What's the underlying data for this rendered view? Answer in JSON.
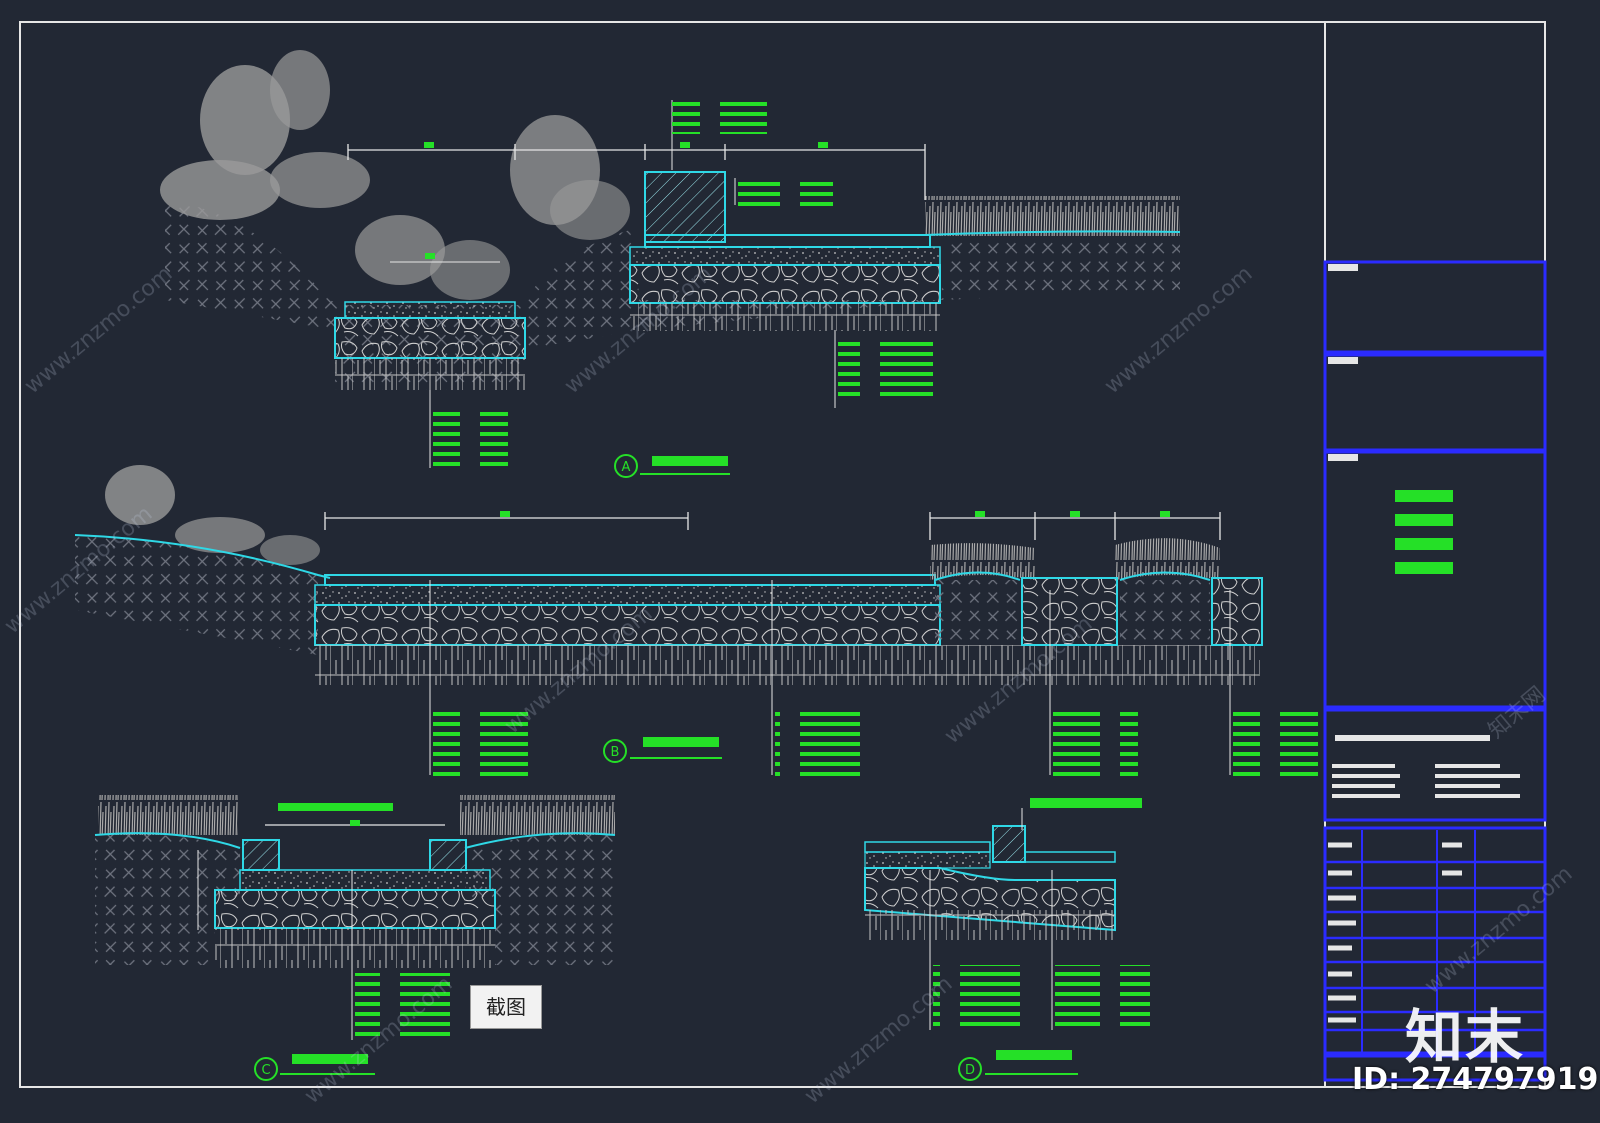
{
  "watermark": {
    "brand": "知末",
    "id_text": "ID: 274797919",
    "url_text": "www.znzmo.com",
    "url_cn_text": "知末网"
  },
  "tooltip": {
    "label": "截图"
  },
  "colors": {
    "background": "#222834",
    "frame": "#e6e6e6",
    "layer_line": "#2fd8e6",
    "note_text": "#25e027",
    "title_block": "#2b2bff",
    "plant": "#9a9a9a"
  },
  "sections": [
    {
      "id": "A",
      "marker": "A"
    },
    {
      "id": "B",
      "marker": "B"
    },
    {
      "id": "C",
      "marker": "C"
    },
    {
      "id": "D",
      "marker": "D"
    }
  ]
}
